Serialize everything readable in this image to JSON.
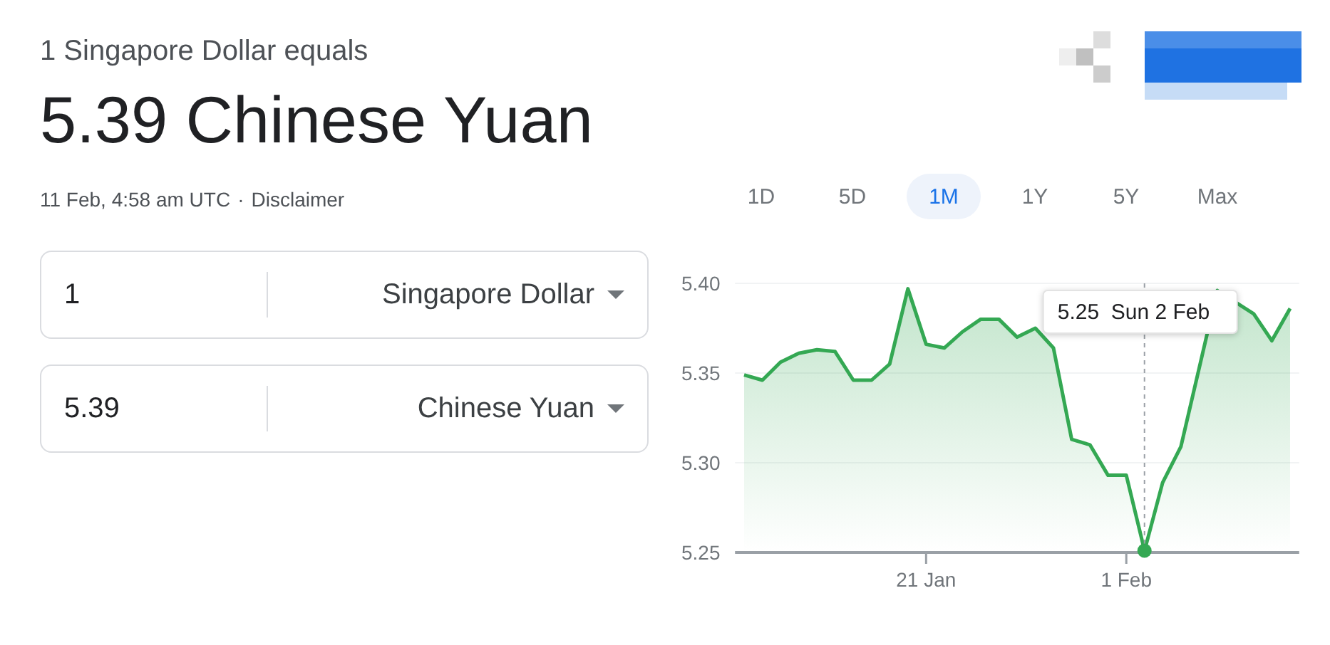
{
  "header": {
    "subtitle": "1 Singapore Dollar equals",
    "result": "5.39 Chinese Yuan",
    "timestamp": "11 Feb, 4:58 am UTC",
    "separator": "·",
    "disclaimer": "Disclaimer"
  },
  "converter": [
    {
      "amount": "1",
      "currency": "Singapore Dollar"
    },
    {
      "amount": "5.39",
      "currency": "Chinese Yuan"
    }
  ],
  "ranges": [
    {
      "label": "1D",
      "selected": false
    },
    {
      "label": "5D",
      "selected": false
    },
    {
      "label": "1M",
      "selected": true
    },
    {
      "label": "1Y",
      "selected": false
    },
    {
      "label": "5Y",
      "selected": false
    },
    {
      "label": "Max",
      "selected": false
    }
  ],
  "chart": {
    "chart_data": {
      "type": "area",
      "categories": [
        null,
        null,
        null,
        null,
        null,
        null,
        null,
        null,
        null,
        null,
        "21 Jan",
        null,
        null,
        null,
        null,
        null,
        null,
        null,
        null,
        null,
        null,
        "1 Feb",
        null,
        null,
        null,
        null,
        null,
        null,
        null,
        null,
        null
      ],
      "values": [
        5.349,
        5.346,
        5.356,
        5.361,
        5.363,
        5.362,
        5.346,
        5.346,
        5.355,
        5.397,
        5.366,
        5.364,
        5.373,
        5.38,
        5.38,
        5.37,
        5.375,
        5.364,
        5.313,
        5.31,
        5.293,
        5.293,
        5.251,
        5.289,
        5.309,
        null,
        5.396,
        null,
        5.383,
        5.368,
        5.386
      ],
      "ylim": [
        5.25,
        5.4
      ],
      "yticks": [
        {
          "value": 5.25,
          "label": "5.25"
        },
        {
          "value": 5.3,
          "label": "5.30"
        },
        {
          "value": 5.35,
          "label": "5.35"
        },
        {
          "value": 5.4,
          "label": "5.40"
        }
      ],
      "annotations": [
        "5.25  Sun 2 Feb"
      ]
    }
  }
}
